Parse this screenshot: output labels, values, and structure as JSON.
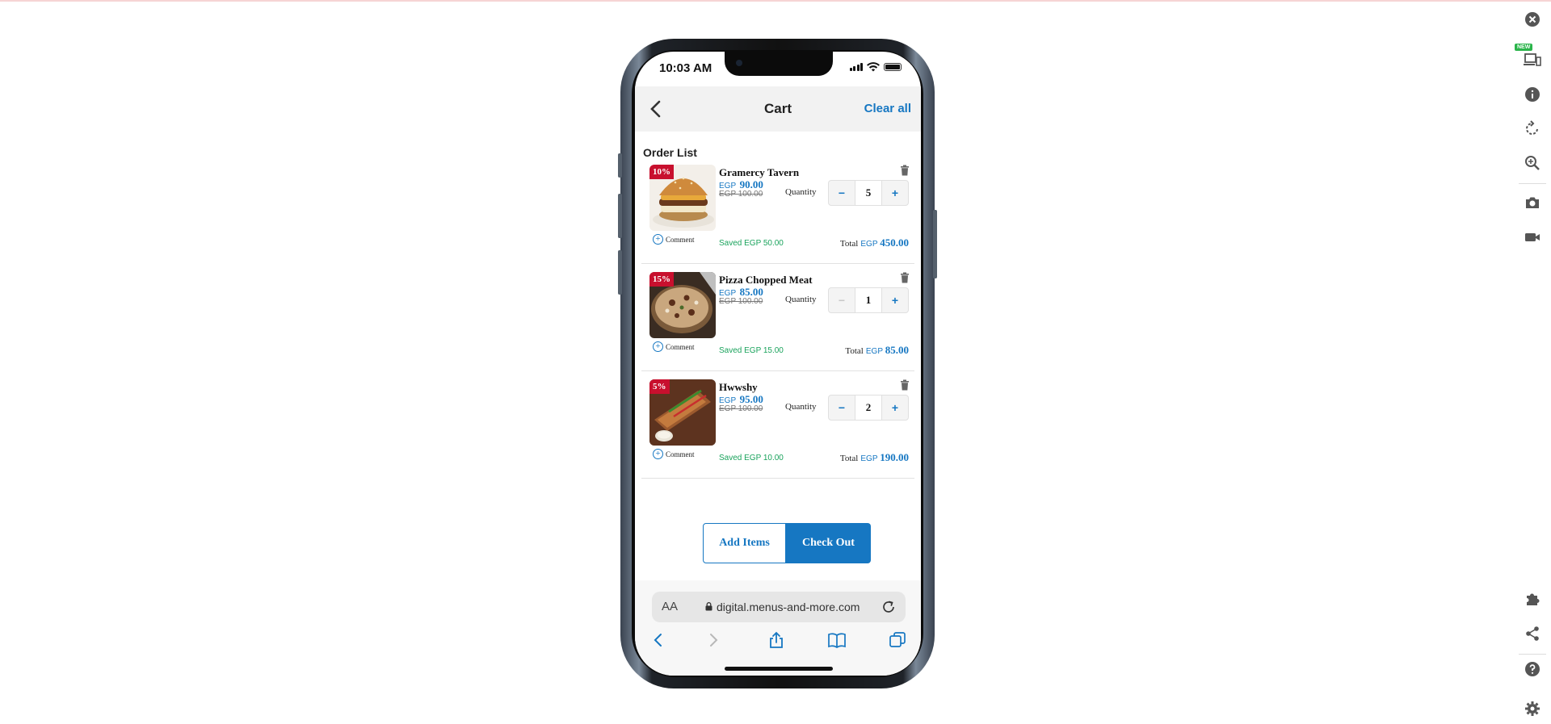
{
  "status_bar": {
    "time": "10:03 AM"
  },
  "header": {
    "title": "Cart",
    "clear_all": "Clear all"
  },
  "order_list_label": "Order List",
  "items": [
    {
      "discount": "10%",
      "name": "Gramercy Tavern",
      "currency": "EGP",
      "price": "90.00",
      "old_price": "EGP 100.00",
      "quantity_label": "Quantity",
      "quantity": "5",
      "comment": "Comment",
      "saved": "Saved EGP 50.00",
      "total_label": "Total",
      "total": "450.00",
      "decrement_enabled": true
    },
    {
      "discount": "15%",
      "name": "Pizza Chopped Meat",
      "currency": "EGP",
      "price": "85.00",
      "old_price": "EGP 100.00",
      "quantity_label": "Quantity",
      "quantity": "1",
      "comment": "Comment",
      "saved": "Saved EGP 15.00",
      "total_label": "Total",
      "total": "85.00",
      "decrement_enabled": false
    },
    {
      "discount": "5%",
      "name": "Hwwshy",
      "currency": "EGP",
      "price": "95.00",
      "old_price": "EGP 100.00",
      "quantity_label": "Quantity",
      "quantity": "2",
      "comment": "Comment",
      "saved": "Saved EGP 10.00",
      "total_label": "Total",
      "total": "190.00",
      "decrement_enabled": true
    }
  ],
  "stepper": {
    "minus": "−",
    "plus": "+"
  },
  "actions": {
    "add_items": "Add Items",
    "check_out": "Check Out"
  },
  "browser": {
    "aa": "AA",
    "url": "digital.menus-and-more.com"
  },
  "toolbar": {
    "new_badge": "NEW"
  },
  "colors": {
    "accent": "#1677c2",
    "discount_badge": "#c8102e",
    "saved": "#1aa35c"
  }
}
